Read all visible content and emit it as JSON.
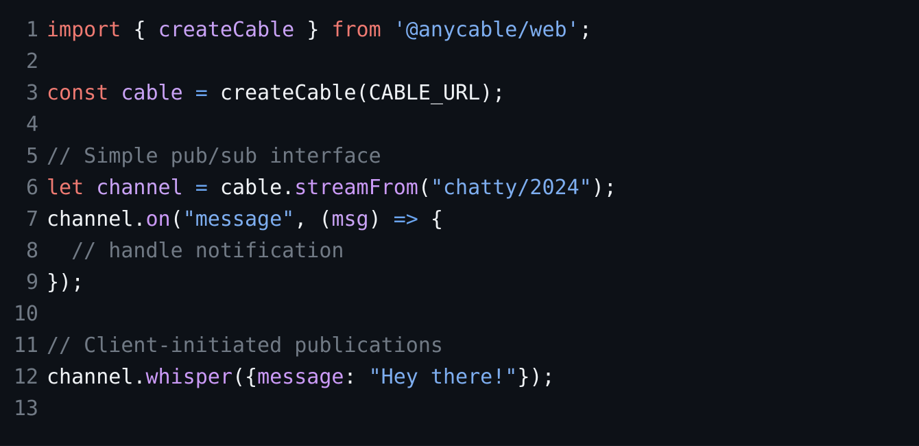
{
  "editor": {
    "language": "javascript",
    "background_color": "#0d1117",
    "default_text_color": "#e6edf3",
    "line_number_color": "#717a85",
    "colors": {
      "keyword": "#ef7a72",
      "variable": "#c9a2f5",
      "function": "#cb9af7",
      "string": "#7eaef0",
      "operator": "#6ba5f0",
      "comment": "#717a85",
      "plain": "#f0f3f6",
      "property": "#cb9af7"
    },
    "line_numbers": [
      "1",
      "2",
      "3",
      "4",
      "5",
      "6",
      "7",
      "8",
      "9",
      "10",
      "11",
      "12",
      "13"
    ],
    "lines": [
      {
        "number": "1",
        "text": "import { createCable } from '@anycable/web';",
        "tokens": [
          {
            "t": "import",
            "c": "keyword"
          },
          {
            "t": " ",
            "c": "plain"
          },
          {
            "t": "{",
            "c": "plain"
          },
          {
            "t": " ",
            "c": "plain"
          },
          {
            "t": "createCable",
            "c": "variable"
          },
          {
            "t": " ",
            "c": "plain"
          },
          {
            "t": "}",
            "c": "plain"
          },
          {
            "t": " ",
            "c": "plain"
          },
          {
            "t": "from",
            "c": "keyword"
          },
          {
            "t": " ",
            "c": "plain"
          },
          {
            "t": "'@anycable/web'",
            "c": "string"
          },
          {
            "t": ";",
            "c": "plain"
          }
        ]
      },
      {
        "number": "2",
        "text": "",
        "tokens": []
      },
      {
        "number": "3",
        "text": "const cable = createCable(CABLE_URL);",
        "tokens": [
          {
            "t": "const",
            "c": "keyword"
          },
          {
            "t": " ",
            "c": "plain"
          },
          {
            "t": "cable",
            "c": "variable"
          },
          {
            "t": " ",
            "c": "plain"
          },
          {
            "t": "=",
            "c": "operator"
          },
          {
            "t": " ",
            "c": "plain"
          },
          {
            "t": "createCable(CABLE_URL);",
            "c": "plain"
          }
        ]
      },
      {
        "number": "4",
        "text": "",
        "tokens": []
      },
      {
        "number": "5",
        "text": "// Simple pub/sub interface",
        "tokens": [
          {
            "t": "// Simple pub/sub interface",
            "c": "comment"
          }
        ]
      },
      {
        "number": "6",
        "text": "let channel = cable.streamFrom(\"chatty/2024\");",
        "tokens": [
          {
            "t": "let",
            "c": "keyword"
          },
          {
            "t": " ",
            "c": "plain"
          },
          {
            "t": "channel",
            "c": "variable"
          },
          {
            "t": " ",
            "c": "plain"
          },
          {
            "t": "=",
            "c": "operator"
          },
          {
            "t": " ",
            "c": "plain"
          },
          {
            "t": "cable.",
            "c": "plain"
          },
          {
            "t": "streamFrom",
            "c": "function"
          },
          {
            "t": "(",
            "c": "plain"
          },
          {
            "t": "\"chatty/2024\"",
            "c": "string"
          },
          {
            "t": ");",
            "c": "plain"
          }
        ]
      },
      {
        "number": "7",
        "text": "channel.on(\"message\", (msg) => {",
        "tokens": [
          {
            "t": "channel.",
            "c": "plain"
          },
          {
            "t": "on",
            "c": "function"
          },
          {
            "t": "(",
            "c": "plain"
          },
          {
            "t": "\"message\"",
            "c": "string"
          },
          {
            "t": ", (",
            "c": "plain"
          },
          {
            "t": "msg",
            "c": "variable"
          },
          {
            "t": ") ",
            "c": "plain"
          },
          {
            "t": "=>",
            "c": "operator"
          },
          {
            "t": " {",
            "c": "plain"
          }
        ]
      },
      {
        "number": "8",
        "text": "  // handle notification",
        "tokens": [
          {
            "t": "  // handle notification",
            "c": "comment"
          }
        ]
      },
      {
        "number": "9",
        "text": "});",
        "tokens": [
          {
            "t": "});",
            "c": "plain"
          }
        ]
      },
      {
        "number": "10",
        "text": "",
        "tokens": []
      },
      {
        "number": "11",
        "text": "// Client-initiated publications",
        "tokens": [
          {
            "t": "// Client-initiated publications",
            "c": "comment"
          }
        ]
      },
      {
        "number": "12",
        "text": "channel.whisper({message: \"Hey there!\"});",
        "tokens": [
          {
            "t": "channel.",
            "c": "plain"
          },
          {
            "t": "whisper",
            "c": "function"
          },
          {
            "t": "({",
            "c": "plain"
          },
          {
            "t": "message",
            "c": "property"
          },
          {
            "t": ": ",
            "c": "plain"
          },
          {
            "t": "\"Hey there!\"",
            "c": "string"
          },
          {
            "t": "});",
            "c": "plain"
          }
        ]
      },
      {
        "number": "13",
        "text": "",
        "tokens": []
      }
    ]
  }
}
